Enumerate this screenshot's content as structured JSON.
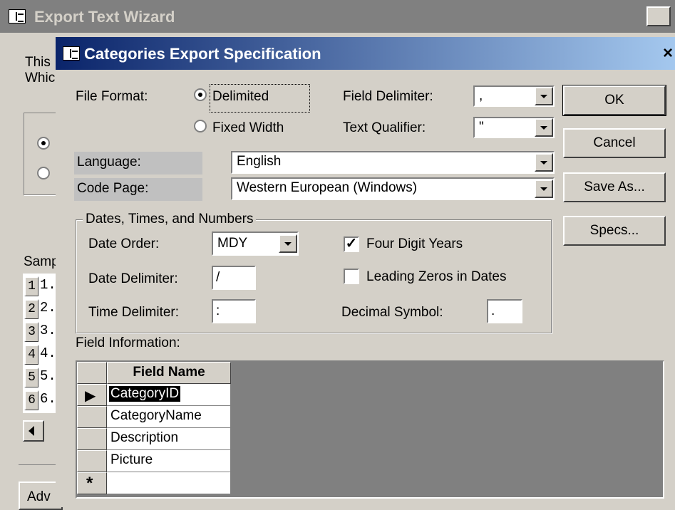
{
  "back_window": {
    "title": "Export Text Wizard",
    "close": "×",
    "intro_line1": "This",
    "intro_line2": "Whic",
    "sample_label": "Samp",
    "rows": [
      "1",
      "2",
      "3",
      "4",
      "5",
      "6"
    ],
    "rows_text": [
      "1.",
      "2.",
      "3.",
      "4.",
      "5.",
      "6."
    ],
    "advanced_button": "Adv"
  },
  "dialog": {
    "title": "Categories Export Specification",
    "close": "×",
    "file_format": {
      "label": "File Format:",
      "options": [
        "Delimited",
        "Fixed Width"
      ],
      "selected": "Delimited"
    },
    "field_delimiter": {
      "label": "Field Delimiter:",
      "value": ","
    },
    "text_qualifier": {
      "label": "Text Qualifier:",
      "value": "\""
    },
    "language": {
      "label": "Language:",
      "value": "English"
    },
    "code_page": {
      "label": "Code Page:",
      "value": "Western European (Windows)"
    },
    "buttons": {
      "ok": "OK",
      "cancel": "Cancel",
      "save_as": "Save As...",
      "specs": "Specs..."
    },
    "dates_group": {
      "title": "Dates, Times, and Numbers",
      "date_order": {
        "label": "Date Order:",
        "value": "MDY"
      },
      "date_delimiter": {
        "label": "Date Delimiter:",
        "value": "/"
      },
      "time_delimiter": {
        "label": "Time Delimiter:",
        "value": ":"
      },
      "four_digit_years": {
        "label": "Four Digit Years",
        "checked": true
      },
      "leading_zeros": {
        "label": "Leading Zeros in Dates",
        "checked": false
      },
      "decimal_symbol": {
        "label": "Decimal Symbol:",
        "value": "."
      }
    },
    "field_info": {
      "label": "Field Information:",
      "column_header": "Field Name",
      "fields": [
        "CategoryID",
        "CategoryName",
        "Description",
        "Picture"
      ],
      "current_marker": "▶",
      "new_row_marker": "*"
    }
  },
  "colors": {
    "dialog_title_start": "#0a246a",
    "dialog_title_end": "#a6caf0",
    "face": "#d4d0c8",
    "inactive_title": "#808080"
  }
}
